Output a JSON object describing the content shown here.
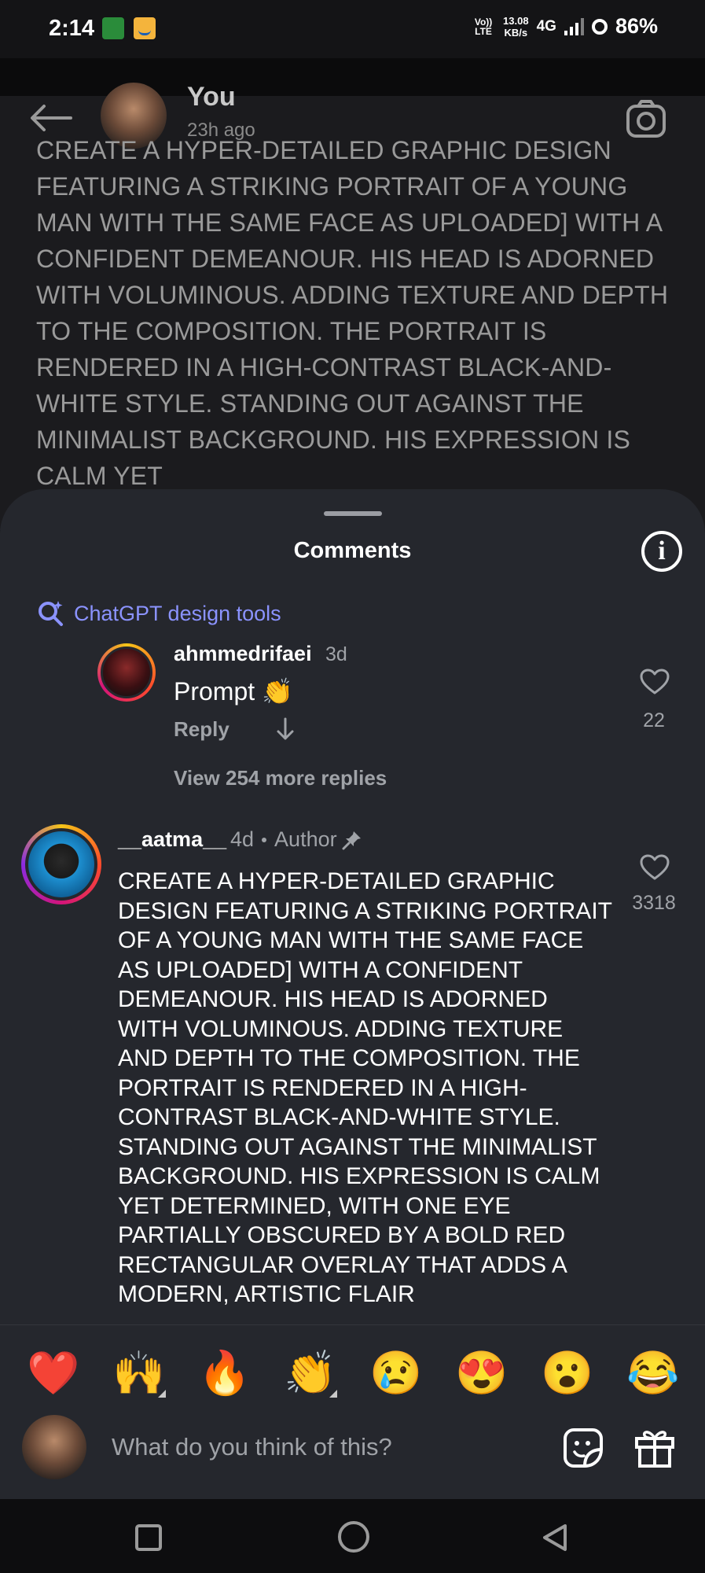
{
  "status_bar": {
    "time": "2:14",
    "volte": "Vo)) LTE",
    "speed_value": "13.08",
    "speed_unit": "KB/s",
    "network": "4G",
    "battery": "86%"
  },
  "post": {
    "username": "You",
    "time": "23h ago",
    "caption": "CREATE A HYPER-DETAILED GRAPHIC DESIGN FEATURING A STRIKING PORTRAIT OF A YOUNG MAN WITH THE SAME FACE AS UPLOADED] WITH A CONFIDENT DEMEANOUR. HIS HEAD IS ADORNED WITH VOLUMINOUS. ADDING TEXTURE AND DEPTH TO THE COMPOSITION. THE PORTRAIT IS RENDERED IN A HIGH-CONTRAST BLACK-AND-WHITE STYLE. STANDING OUT AGAINST THE MINIMALIST BACKGROUND. HIS EXPRESSION IS CALM YET"
  },
  "sheet": {
    "title": "Comments",
    "search_hint": "ChatGPT design tools"
  },
  "reply": {
    "username": "ahmmedrifaei",
    "age": "3d",
    "text": "Prompt 👏",
    "reply_label": "Reply",
    "likes": "22",
    "view_more": "View 254 more replies"
  },
  "main_comment": {
    "username": "__aatma__",
    "age": "4d",
    "author_label": "Author",
    "likes": "3318",
    "text": "CREATE A HYPER-DETAILED GRAPHIC DESIGN FEATURING A STRIKING PORTRAIT OF A YOUNG MAN WITH THE SAME FACE AS UPLOADED] WITH A CONFIDENT DEMEANOUR. HIS HEAD IS ADORNED WITH VOLUMINOUS. ADDING TEXTURE AND DEPTH TO THE COMPOSITION. THE PORTRAIT IS RENDERED IN A HIGH-CONTRAST BLACK-AND-WHITE STYLE. STANDING OUT AGAINST THE MINIMALIST BACKGROUND. HIS EXPRESSION IS CALM YET DETERMINED, WITH ONE EYE PARTIALLY OBSCURED BY A BOLD RED RECTANGULAR OVERLAY THAT ADDS A MODERN, ARTISTIC FLAIR"
  },
  "emoji_bar": [
    {
      "emoji": "❤️",
      "name": "red-heart"
    },
    {
      "emoji": "🙌",
      "name": "raising-hands",
      "variants": true
    },
    {
      "emoji": "🔥",
      "name": "fire"
    },
    {
      "emoji": "👏",
      "name": "clapping-hands",
      "variants": true
    },
    {
      "emoji": "😢",
      "name": "crying-face"
    },
    {
      "emoji": "😍",
      "name": "heart-eyes"
    },
    {
      "emoji": "😮",
      "name": "open-mouth"
    },
    {
      "emoji": "😂",
      "name": "tears-of-joy"
    }
  ],
  "composer": {
    "placeholder": "What do you think of this?"
  },
  "colors": {
    "sheet_bg": "#25272d",
    "accent_link": "#8b93ff",
    "muted_text": "#a0a3a8"
  }
}
